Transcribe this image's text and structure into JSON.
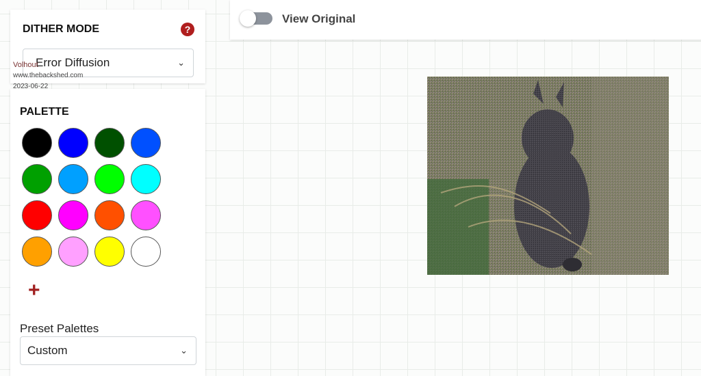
{
  "dither": {
    "title": "DITHER MODE",
    "help_icon": "question-icon",
    "selected": "Error Diffusion",
    "chevron": "chevron-down-icon"
  },
  "watermark": {
    "name": "Volhout",
    "site": "www.thebackshed.com",
    "date": "2023-06-22"
  },
  "palette": {
    "title": "PALETTE",
    "swatches": [
      "#000000",
      "#0000ff",
      "#005000",
      "#0050ff",
      "#00a000",
      "#00a0ff",
      "#00ff00",
      "#00ffff",
      "#ff0000",
      "#ff00ff",
      "#ff5000",
      "#ff50ff",
      "#ffa000",
      "#ffa0ff",
      "#ffff00",
      "#ffffff"
    ],
    "add_icon": "plus-icon",
    "add_symbol": "+"
  },
  "presets": {
    "label": "Preset Palettes",
    "selected": "Custom"
  },
  "topbar": {
    "toggle_state": "off",
    "view_original_label": "View Original"
  },
  "preview": {
    "subject": "dithered wallaby photo"
  }
}
